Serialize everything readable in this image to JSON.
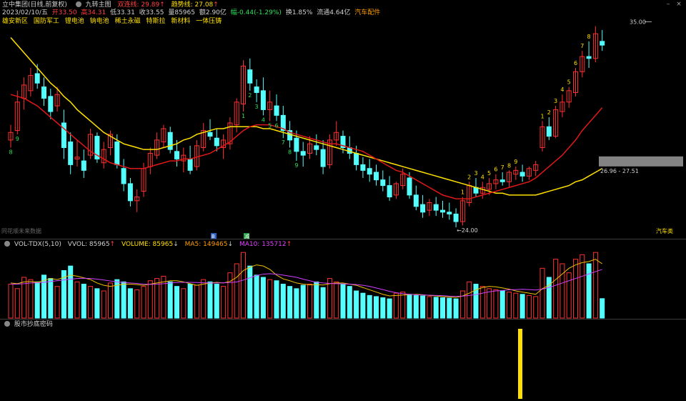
{
  "header": {
    "stock": "立中集团(日线,前复权)",
    "indicator_icon": "circle-icon",
    "indicator": "九转主图",
    "short_line_label": "双连线: 29.89",
    "short_line_arrow": "↑",
    "trend_line_label": "趋势线: 27.08",
    "trend_line_arrow": "↑",
    "date": "2023/02/10/五",
    "open": "开33.50",
    "high": "高34.31",
    "low": "低33.31",
    "close": "收33.55",
    "volume": "量85965",
    "amount": "额2.90亿",
    "change": "幅-0.44(-1.29%)",
    "turnover": "换1.85%",
    "float": "流通4.64亿",
    "sector": "汽车配件"
  },
  "concepts": [
    "雄安新区",
    "国防军工",
    "锂电池",
    "钠电池",
    "稀土永磁",
    "特斯拉",
    "新材料",
    "一体压铸"
  ],
  "chart_labels": {
    "high_price": "35.00",
    "low_price": "←24.00",
    "range_label": "26.96 - 27.51",
    "watermark": "同花顺未来数据",
    "sector_tag": "汽车类",
    "marker_1": "B",
    "marker_2": "减"
  },
  "volume_panel": {
    "title": "VOL-TDX(5,10)",
    "vvol": "VVOL: 85965",
    "vvol_arrow": "↑",
    "volume": "VOLUME: 85965",
    "volume_arrow": "↓",
    "ma5": "MA5: 149465",
    "ma5_arrow": "↓",
    "ma10": "MA10: 135712",
    "ma10_arrow": "↑"
  },
  "bottom_panel": {
    "title": "股市抄底密码"
  },
  "colors": {
    "up": "#ff3030",
    "down": "#54ffff",
    "ma_short": "#e01818",
    "ma_trend": "#ffe000",
    "ma5": "#f0c000",
    "ma10": "#d040ff",
    "bg": "#000000"
  },
  "chart_data": {
    "type": "candlestick",
    "ylim": [
      24.0,
      35.0
    ],
    "candles": [
      [
        28.6,
        29.4,
        28.2,
        29.0
      ],
      [
        29.1,
        31.2,
        28.9,
        30.6
      ],
      [
        30.8,
        31.9,
        30.2,
        31.5
      ],
      [
        31.2,
        32.4,
        30.9,
        32.0
      ],
      [
        32.1,
        32.6,
        31.3,
        31.6
      ],
      [
        31.4,
        31.9,
        30.4,
        30.8
      ],
      [
        30.9,
        31.3,
        29.7,
        30.1
      ],
      [
        30.4,
        31.4,
        30.1,
        31.0
      ],
      [
        29.5,
        30.2,
        27.6,
        28.2
      ],
      [
        28.5,
        29.0,
        26.8,
        27.3
      ],
      [
        27.6,
        28.6,
        27.2,
        27.7
      ],
      [
        27.5,
        28.1,
        26.6,
        27.0
      ],
      [
        27.8,
        29.2,
        27.6,
        28.9
      ],
      [
        28.8,
        29.0,
        27.4,
        27.6
      ],
      [
        27.4,
        28.5,
        27.1,
        28.1
      ],
      [
        28.2,
        29.1,
        27.8,
        28.9
      ],
      [
        28.5,
        28.9,
        27.1,
        27.3
      ],
      [
        27.1,
        27.6,
        25.9,
        26.3
      ],
      [
        26.3,
        26.6,
        25.1,
        25.4
      ],
      [
        25.4,
        26.0,
        24.8,
        25.6
      ],
      [
        25.9,
        27.4,
        25.6,
        27.1
      ],
      [
        27.2,
        28.2,
        26.8,
        27.9
      ],
      [
        27.8,
        29.0,
        27.6,
        28.6
      ],
      [
        28.5,
        29.4,
        28.2,
        29.2
      ],
      [
        29.0,
        29.3,
        27.9,
        28.1
      ],
      [
        28.0,
        28.6,
        27.2,
        27.6
      ],
      [
        27.5,
        28.2,
        26.9,
        27.8
      ],
      [
        27.6,
        28.3,
        26.8,
        27.0
      ],
      [
        27.2,
        28.6,
        27.0,
        28.3
      ],
      [
        28.2,
        29.5,
        28.0,
        29.1
      ],
      [
        29.0,
        29.7,
        28.6,
        28.8
      ],
      [
        28.7,
        29.2,
        28.0,
        28.3
      ],
      [
        28.2,
        28.9,
        27.6,
        28.6
      ],
      [
        28.4,
        29.8,
        28.1,
        29.5
      ],
      [
        29.4,
        30.8,
        29.0,
        30.6
      ],
      [
        30.5,
        32.8,
        30.1,
        32.5
      ],
      [
        32.3,
        32.9,
        31.2,
        31.6
      ],
      [
        31.4,
        31.8,
        30.6,
        31.1
      ],
      [
        31.2,
        31.9,
        29.9,
        30.2
      ],
      [
        30.2,
        31.2,
        29.6,
        30.6
      ],
      [
        30.4,
        31.0,
        29.6,
        29.9
      ],
      [
        29.9,
        30.4,
        28.7,
        29.1
      ],
      [
        29.1,
        29.6,
        28.2,
        28.6
      ],
      [
        28.7,
        29.1,
        27.5,
        28.0
      ],
      [
        28.0,
        28.5,
        27.2,
        27.8
      ],
      [
        27.9,
        28.8,
        27.6,
        28.4
      ],
      [
        28.3,
        28.9,
        27.8,
        28.1
      ],
      [
        28.1,
        28.6,
        26.8,
        27.2
      ],
      [
        27.3,
        28.9,
        27.1,
        28.6
      ],
      [
        28.6,
        29.6,
        28.3,
        29.0
      ],
      [
        28.8,
        29.1,
        27.9,
        28.2
      ],
      [
        28.2,
        28.8,
        27.6,
        27.9
      ],
      [
        27.9,
        28.3,
        27.0,
        27.3
      ],
      [
        27.3,
        27.7,
        26.6,
        27.0
      ],
      [
        27.1,
        27.6,
        26.4,
        26.8
      ],
      [
        26.9,
        27.3,
        26.2,
        26.5
      ],
      [
        26.5,
        27.0,
        25.9,
        26.2
      ],
      [
        26.2,
        26.7,
        25.4,
        25.6
      ],
      [
        25.7,
        26.4,
        25.5,
        26.3
      ],
      [
        26.2,
        27.1,
        26.0,
        26.8
      ],
      [
        26.6,
        26.9,
        25.5,
        25.7
      ],
      [
        25.7,
        26.2,
        24.9,
        25.1
      ],
      [
        25.2,
        25.7,
        24.5,
        24.8
      ],
      [
        24.9,
        25.5,
        24.6,
        25.3
      ],
      [
        25.2,
        25.6,
        24.6,
        24.9
      ],
      [
        24.9,
        25.4,
        24.5,
        24.8
      ],
      [
        24.8,
        25.3,
        24.4,
        24.7
      ],
      [
        24.7,
        25.0,
        24.0,
        24.3
      ],
      [
        24.3,
        25.6,
        24.1,
        25.4
      ],
      [
        25.3,
        26.4,
        25.1,
        26.2
      ],
      [
        26.1,
        26.6,
        25.6,
        25.8
      ],
      [
        25.8,
        26.4,
        25.5,
        26.1
      ],
      [
        26.0,
        26.6,
        25.7,
        26.3
      ],
      [
        26.3,
        26.8,
        26.0,
        26.5
      ],
      [
        26.5,
        26.9,
        26.2,
        26.4
      ],
      [
        26.4,
        27.0,
        26.1,
        26.9
      ],
      [
        26.8,
        27.2,
        26.5,
        27.0
      ],
      [
        26.9,
        27.3,
        26.4,
        26.7
      ],
      [
        26.7,
        27.2,
        26.5,
        27.1
      ],
      [
        27.0,
        27.5,
        26.7,
        27.3
      ],
      [
        28.2,
        29.6,
        28.0,
        29.3
      ],
      [
        29.3,
        29.8,
        28.6,
        28.8
      ],
      [
        28.8,
        30.4,
        28.7,
        30.2
      ],
      [
        30.1,
        31.0,
        29.8,
        30.6
      ],
      [
        30.6,
        31.4,
        30.3,
        31.2
      ],
      [
        31.1,
        32.4,
        30.9,
        32.2
      ],
      [
        32.2,
        33.3,
        31.9,
        33.0
      ],
      [
        33.0,
        33.8,
        32.4,
        32.9
      ],
      [
        32.9,
        34.6,
        32.7,
        34.2
      ],
      [
        33.8,
        34.4,
        33.3,
        33.6
      ]
    ],
    "ma_short_line": [
      31.0,
      30.9,
      30.8,
      30.6,
      30.4,
      30.1,
      29.8,
      29.5,
      29.2,
      28.9,
      28.6,
      28.3,
      28.0,
      27.8,
      27.6,
      27.4,
      27.3,
      27.2,
      27.1,
      27.1,
      27.1,
      27.2,
      27.3,
      27.4,
      27.5,
      27.5,
      27.6,
      27.6,
      27.7,
      27.8,
      27.9,
      28.1,
      28.3,
      28.5,
      28.8,
      29.1,
      29.3,
      29.4,
      29.4,
      29.4,
      29.3,
      29.2,
      29.0,
      28.9,
      28.8,
      28.7,
      28.6,
      28.5,
      28.4,
      28.4,
      28.3,
      28.2,
      28.1,
      28.0,
      27.8,
      27.6,
      27.4,
      27.2,
      27.0,
      26.9,
      26.7,
      26.5,
      26.3,
      26.1,
      25.9,
      25.7,
      25.6,
      25.5,
      25.5,
      25.5,
      25.6,
      25.7,
      25.8,
      25.9,
      26.0,
      26.1,
      26.2,
      26.3,
      26.4,
      26.6,
      26.9,
      27.2,
      27.5,
      27.8,
      28.2,
      28.6,
      29.1,
      29.5,
      29.9,
      30.3
    ],
    "ma_trend_line": [
      34.0,
      33.6,
      33.2,
      32.8,
      32.4,
      32.0,
      31.6,
      31.3,
      30.9,
      30.6,
      30.2,
      29.9,
      29.6,
      29.3,
      29.0,
      28.8,
      28.6,
      28.4,
      28.3,
      28.2,
      28.1,
      28.1,
      28.1,
      28.2,
      28.3,
      28.4,
      28.6,
      28.7,
      28.9,
      29.0,
      29.1,
      29.2,
      29.2,
      29.3,
      29.3,
      29.3,
      29.3,
      29.3,
      29.2,
      29.2,
      29.1,
      29.0,
      28.9,
      28.8,
      28.7,
      28.6,
      28.5,
      28.4,
      28.3,
      28.2,
      28.1,
      28.0,
      27.9,
      27.8,
      27.7,
      27.6,
      27.5,
      27.4,
      27.3,
      27.2,
      27.1,
      27.0,
      26.9,
      26.8,
      26.7,
      26.6,
      26.5,
      26.4,
      26.3,
      26.2,
      26.1,
      26.0,
      25.9,
      25.8,
      25.8,
      25.7,
      25.7,
      25.7,
      25.7,
      25.7,
      25.8,
      25.9,
      26.0,
      26.1,
      26.2,
      26.4,
      26.5,
      26.7,
      26.9,
      27.1
    ],
    "td_counts": [
      {
        "i": 0,
        "n": "8",
        "dir": "down"
      },
      {
        "i": 1,
        "n": "9",
        "dir": "down"
      },
      {
        "i": 35,
        "n": "1",
        "dir": "down"
      },
      {
        "i": 36,
        "n": "2",
        "dir": "down"
      },
      {
        "i": 37,
        "n": "3",
        "dir": "down"
      },
      {
        "i": 38,
        "n": "4",
        "dir": "down"
      },
      {
        "i": 39,
        "n": "5",
        "dir": "down"
      },
      {
        "i": 40,
        "n": "6",
        "dir": "down"
      },
      {
        "i": 41,
        "n": "7",
        "dir": "down"
      },
      {
        "i": 42,
        "n": "8",
        "dir": "down"
      },
      {
        "i": 43,
        "n": "9",
        "dir": "down"
      },
      {
        "i": 68,
        "n": "1",
        "dir": "up"
      },
      {
        "i": 69,
        "n": "2",
        "dir": "up"
      },
      {
        "i": 70,
        "n": "3",
        "dir": "up"
      },
      {
        "i": 71,
        "n": "4",
        "dir": "up"
      },
      {
        "i": 72,
        "n": "5",
        "dir": "up"
      },
      {
        "i": 73,
        "n": "6",
        "dir": "up"
      },
      {
        "i": 74,
        "n": "7",
        "dir": "up"
      },
      {
        "i": 75,
        "n": "8",
        "dir": "up"
      },
      {
        "i": 76,
        "n": "9",
        "dir": "up"
      },
      {
        "i": 80,
        "n": "1",
        "dir": "up"
      },
      {
        "i": 81,
        "n": "2",
        "dir": "up"
      },
      {
        "i": 82,
        "n": "3",
        "dir": "up"
      },
      {
        "i": 83,
        "n": "4",
        "dir": "up"
      },
      {
        "i": 84,
        "n": "5",
        "dir": "up"
      },
      {
        "i": 85,
        "n": "6",
        "dir": "up"
      },
      {
        "i": 86,
        "n": "7",
        "dir": "up"
      },
      {
        "i": 87,
        "n": "8",
        "dir": "up"
      }
    ],
    "volume": [
      150000,
      130000,
      180000,
      170000,
      160000,
      190000,
      175000,
      140000,
      210000,
      230000,
      160000,
      150000,
      140000,
      130000,
      120000,
      155000,
      170000,
      160000,
      130000,
      125000,
      140000,
      165000,
      175000,
      185000,
      160000,
      140000,
      130000,
      150000,
      145000,
      170000,
      160000,
      150000,
      140000,
      200000,
      240000,
      290000,
      230000,
      190000,
      180000,
      170000,
      165000,
      150000,
      140000,
      130000,
      145000,
      150000,
      160000,
      135000,
      175000,
      160000,
      150000,
      140000,
      120000,
      110000,
      100000,
      95000,
      90000,
      85000,
      110000,
      115000,
      105000,
      100000,
      98000,
      95000,
      92000,
      90000,
      88000,
      85000,
      120000,
      160000,
      150000,
      140000,
      130000,
      125000,
      120000,
      115000,
      110000,
      105000,
      100000,
      95000,
      220000,
      180000,
      260000,
      240000,
      200000,
      260000,
      280000,
      240000,
      290000,
      85965
    ],
    "vol_ma5": [
      155000,
      152000,
      160000,
      162000,
      158000,
      166000,
      175000,
      170000,
      180000,
      190000,
      185000,
      178000,
      170000,
      155000,
      145000,
      140000,
      145000,
      150000,
      150000,
      148000,
      145000,
      150000,
      155000,
      160000,
      165000,
      165000,
      160000,
      152000,
      145000,
      150000,
      155000,
      158000,
      155000,
      162000,
      180000,
      210000,
      225000,
      235000,
      230000,
      215000,
      190000,
      173000,
      165000,
      155000,
      150000,
      147000,
      148000,
      146000,
      152000,
      155000,
      155000,
      150000,
      145000,
      135000,
      125000,
      115000,
      105000,
      98000,
      100000,
      102000,
      104000,
      105000,
      103000,
      100000,
      98000,
      95000,
      93000,
      91000,
      98000,
      110000,
      125000,
      135000,
      140000,
      138000,
      133000,
      128000,
      120000,
      115000,
      110000,
      105000,
      130000,
      145000,
      170000,
      195000,
      220000,
      235000,
      245000,
      250000,
      260000,
      240000
    ],
    "vol_ma10": [
      150000,
      150000,
      152000,
      155000,
      156000,
      158000,
      162000,
      165000,
      168000,
      172000,
      175000,
      176000,
      175000,
      172000,
      168000,
      164000,
      160000,
      157000,
      155000,
      153000,
      150000,
      149000,
      150000,
      152000,
      155000,
      157000,
      158000,
      158000,
      157000,
      156000,
      155000,
      155000,
      156000,
      157000,
      160000,
      168000,
      178000,
      188000,
      194000,
      196000,
      194000,
      190000,
      185000,
      180000,
      172000,
      165000,
      158000,
      155000,
      153000,
      152000,
      151000,
      150000,
      148000,
      145000,
      140000,
      133000,
      126000,
      118000,
      112000,
      108000,
      105000,
      103000,
      102000,
      101000,
      100000,
      99000,
      97000,
      96000,
      97000,
      100000,
      104000,
      110000,
      116000,
      120000,
      122000,
      125000,
      126000,
      127000,
      126000,
      124000,
      128000,
      135000,
      145000,
      155000,
      165000,
      175000,
      185000,
      195000,
      205000,
      215000
    ],
    "signal_bar_index": 66
  }
}
